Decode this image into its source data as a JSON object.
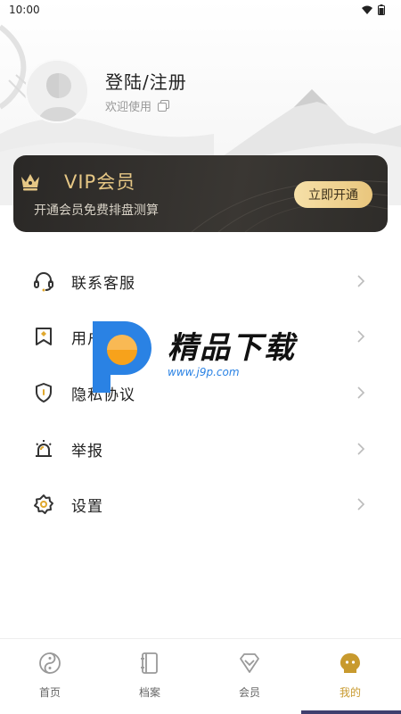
{
  "status_bar": {
    "time": "10:00"
  },
  "profile": {
    "login_title": "登陆/注册",
    "welcome_text": "欢迎使用"
  },
  "vip": {
    "title": "VIP会员",
    "subtitle": "开通会员免费排盘测算",
    "button_label": "立即开通",
    "accent_color": "#e6c785"
  },
  "menu": {
    "items": [
      {
        "label": "联系客服",
        "icon": "headset-icon"
      },
      {
        "label": "用户协议",
        "icon": "bookmark-icon"
      },
      {
        "label": "隐私协议",
        "icon": "shield-icon"
      },
      {
        "label": "举报",
        "icon": "alarm-icon"
      },
      {
        "label": "设置",
        "icon": "gear-icon"
      }
    ]
  },
  "watermark": {
    "title": "精品下载",
    "url": "www.j9p.com"
  },
  "bottom_nav": {
    "items": [
      {
        "label": "首页",
        "icon": "yin-yang-icon",
        "active": false
      },
      {
        "label": "档案",
        "icon": "notebook-icon",
        "active": false
      },
      {
        "label": "会员",
        "icon": "diamond-icon",
        "active": false
      },
      {
        "label": "我的",
        "icon": "profile-face-icon",
        "active": true
      }
    ],
    "active_color": "#c89a2e"
  }
}
